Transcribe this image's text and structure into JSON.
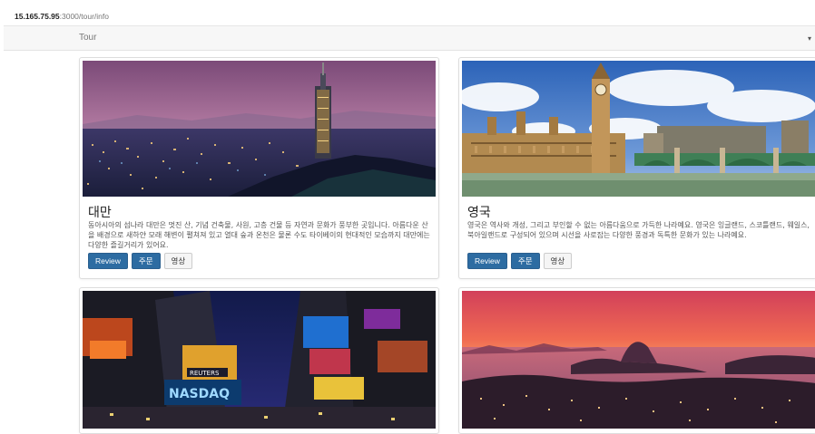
{
  "browser": {
    "url_host": "15.165.75.95",
    "url_path": ":3000/tour/info"
  },
  "navbar": {
    "brand": "Tour",
    "toggle_icon": "caret-down-icon"
  },
  "cards": [
    {
      "title": "대만",
      "description": "동아시아의 섬나라 대만은 멋진 산, 기념 건축물, 사원, 고층 건물 등 자연과 문화가 풍부한 곳입니다. 아름다운 산을 배경으로 새하얀 모래 해변이 펼쳐져 있고 열대 숲과 온천은 물론 수도 타이베이의 현대적인 모습까지 대만에는 다양한 즐길거리가 있어요.",
      "buttons": {
        "review": "Review",
        "order": "주문",
        "video": "영상"
      },
      "photo": "taipei-night-skyline"
    },
    {
      "title": "영국",
      "description": "영국은 역사와 개성, 그리고 부인할 수 없는 아름다움으로 가득한 나라예요. 영국은 잉글랜드, 스코틀랜드, 웨일스, 북아일랜드로 구성되어 있으며 시선을 사로잡는 다양한 풍경과 독특한 문화가 있는 나라예요.",
      "buttons": {
        "review": "Review",
        "order": "주문",
        "video": "영상"
      },
      "photo": "london-big-ben"
    },
    {
      "photo": "times-square-night"
    },
    {
      "photo": "rio-sunset-bay"
    }
  ],
  "colors": {
    "primary_button": "#2d6ca2",
    "navbar_bg": "#f7f7f7"
  }
}
